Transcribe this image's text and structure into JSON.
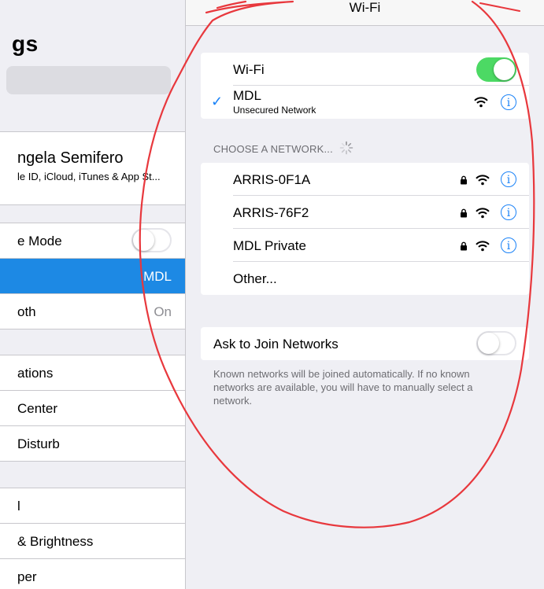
{
  "master": {
    "title": "gs",
    "profile": {
      "name": "ngela Semifero",
      "subtitle": "le ID, iCloud, iTunes & App St..."
    },
    "group2": [
      {
        "label": "e Mode",
        "toggle": "off"
      },
      {
        "label": "",
        "value": "MDL",
        "selected": true
      },
      {
        "label": "oth",
        "value": "On"
      }
    ],
    "group3": [
      {
        "label": "ations"
      },
      {
        "label": "Center"
      },
      {
        "label": "Disturb"
      }
    ],
    "group4": [
      {
        "label": "l"
      },
      {
        "label": "& Brightness"
      },
      {
        "label": "per"
      }
    ]
  },
  "detail": {
    "nav_title": "Wi-Fi",
    "wifi_label": "Wi-Fi",
    "wifi_on": true,
    "current_network": {
      "name": "MDL",
      "status": "Unsecured Network"
    },
    "choose_header": "CHOOSE A NETWORK...",
    "networks": [
      {
        "name": "ARRIS-0F1A",
        "locked": true
      },
      {
        "name": "ARRIS-76F2",
        "locked": true
      },
      {
        "name": "MDL Private",
        "locked": true
      }
    ],
    "other_label": "Other...",
    "ask_label": "Ask to Join Networks",
    "ask_on": false,
    "footnote": "Known networks will be joined automatically. If no known networks are available, you will have to manually select a network."
  },
  "colors": {
    "accent": "#1a82f7",
    "toggle_on": "#4cd964",
    "selected_row": "#1d89e4",
    "annotation": "#e8383d"
  },
  "icons": [
    "checkmark-icon",
    "wifi-icon",
    "lock-icon",
    "info-icon",
    "spinner-icon"
  ]
}
